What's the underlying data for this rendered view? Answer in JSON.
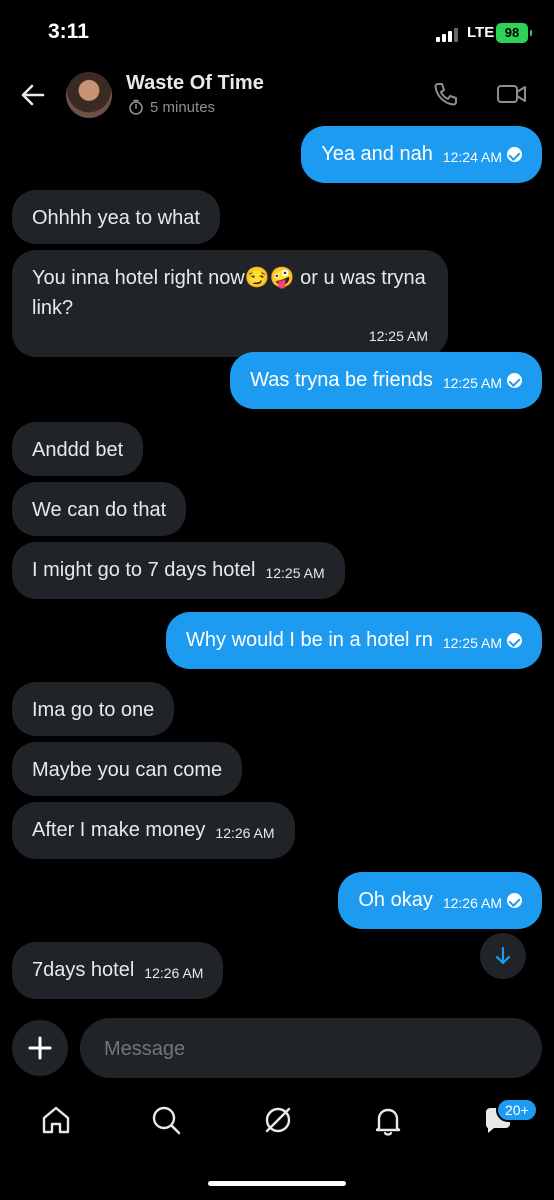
{
  "status": {
    "time": "3:11",
    "network": "LTE",
    "battery": "98"
  },
  "header": {
    "title": "Waste Of Time",
    "subtitle": "5 minutes"
  },
  "messages": [
    {
      "dir": "out",
      "text": "Yea and nah",
      "time": "12:24 AM"
    },
    {
      "dir": "in",
      "text": "Ohhhh yea to what",
      "time": ""
    },
    {
      "dir": "in",
      "text": "You inna hotel right now😏🤪 or u was tryna link?",
      "time": "12:25 AM"
    },
    {
      "dir": "out",
      "text": "Was tryna be friends",
      "time": "12:25 AM"
    },
    {
      "dir": "in",
      "text": "Anddd bet",
      "time": ""
    },
    {
      "dir": "in",
      "text": "We can do that",
      "time": ""
    },
    {
      "dir": "in",
      "text": "I might go to 7 days hotel",
      "time": "12:25 AM"
    },
    {
      "dir": "out",
      "text": "Why would I be in a hotel rn",
      "time": "12:25 AM"
    },
    {
      "dir": "in",
      "text": "Ima go to one",
      "time": ""
    },
    {
      "dir": "in",
      "text": "Maybe you can come",
      "time": ""
    },
    {
      "dir": "in",
      "text": "After I make money",
      "time": "12:26 AM"
    },
    {
      "dir": "out",
      "text": "Oh okay",
      "time": "12:26 AM"
    },
    {
      "dir": "in",
      "text": "7days hotel",
      "time": "12:26 AM"
    }
  ],
  "composer": {
    "placeholder": "Message"
  },
  "tabs": [
    {
      "name": "home",
      "icon": "home-icon"
    },
    {
      "name": "search",
      "icon": "search-icon"
    },
    {
      "name": "grok",
      "icon": "slash-circle-icon"
    },
    {
      "name": "notifications",
      "icon": "bell-icon"
    },
    {
      "name": "messages",
      "icon": "chat-icon",
      "badge": "20+"
    }
  ],
  "colors": {
    "accent": "#1d9bf0",
    "bubble_in": "#202327",
    "background": "#000000"
  }
}
